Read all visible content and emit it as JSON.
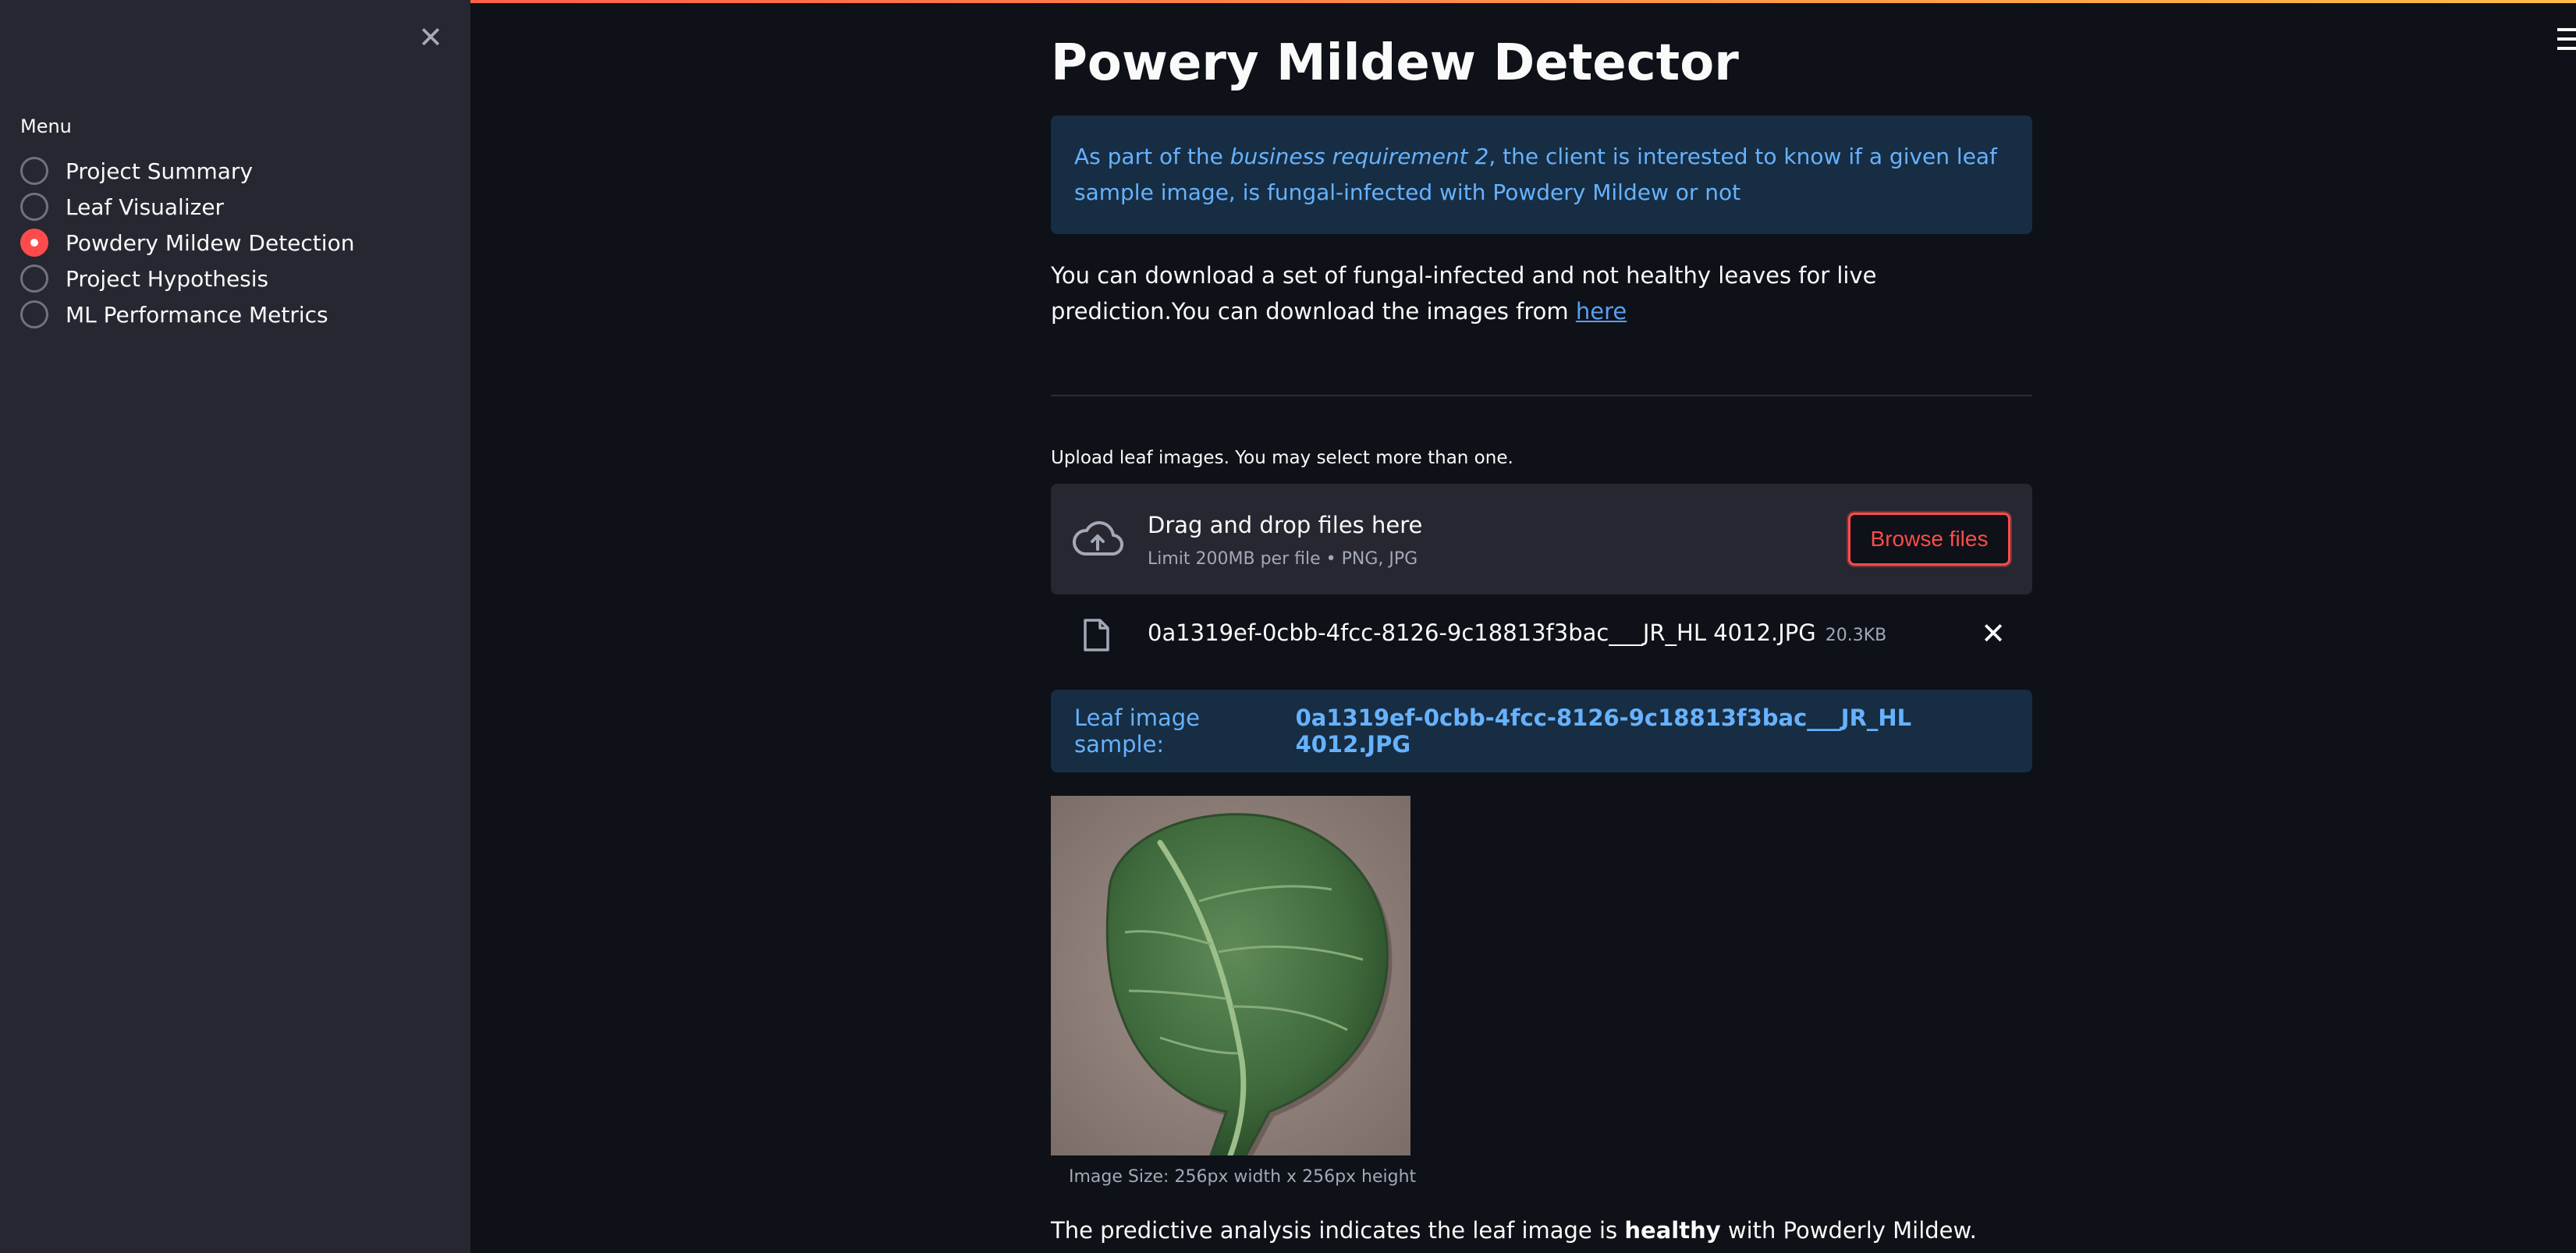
{
  "sidebar": {
    "close_glyph": "✕",
    "menu_label": "Menu",
    "items": [
      {
        "label": "Project Summary",
        "selected": false
      },
      {
        "label": "Leaf Visualizer",
        "selected": false
      },
      {
        "label": "Powdery Mildew Detection",
        "selected": true
      },
      {
        "label": "Project Hypothesis",
        "selected": false
      },
      {
        "label": "ML Performance Metrics",
        "selected": false
      }
    ]
  },
  "header": {
    "menu_icon": "hamburger-icon"
  },
  "main": {
    "title": "Powery Mildew Detector",
    "info": {
      "prefix": "As part of the ",
      "emphasis": "business requirement 2",
      "suffix": ", the client is interested to know if a given leaf sample image, is fungal-infected with Powdery Mildew or not"
    },
    "download": {
      "text": "You can download a set of fungal-infected and not healthy leaves for live prediction.You can download the images from ",
      "link": "here"
    },
    "upload": {
      "label": "Upload leaf images. You may select more than one.",
      "drop_title": "Drag and drop files here",
      "drop_sub": "Limit 200MB per file • PNG, JPG",
      "browse_label": "Browse files",
      "file_name": "0a1319ef-0cbb-4fcc-8126-9c18813f3bac___JR_HL 4012.JPG",
      "file_size": "20.3KB",
      "remove_glyph": "✕"
    },
    "sample": {
      "label": "Leaf image sample:",
      "file": "0a1319ef-0cbb-4fcc-8126-9c18813f3bac___JR_HL 4012.JPG"
    },
    "caption": "Image Size: 256px width x 256px height",
    "result": {
      "prefix": "The predictive analysis indicates the leaf image is ",
      "status": "healthy",
      "suffix": " with Powderly Mildew."
    }
  },
  "colors": {
    "background": "#0e1117",
    "sidebar": "#262730",
    "accent": "#ff4b4b",
    "info_bg": "#172d43",
    "info_text": "#66b2ff"
  }
}
